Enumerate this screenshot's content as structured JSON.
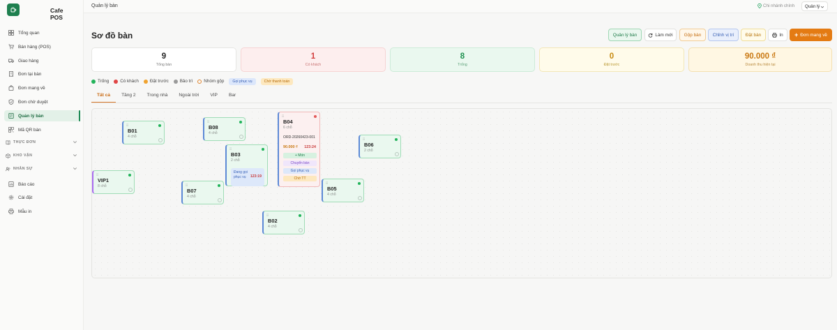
{
  "app": {
    "brand": "Cafe POS",
    "logo_icon": "cup-icon",
    "accent": "#1e7f4f"
  },
  "sidebar": {
    "items": [
      {
        "label": "Tổng quan",
        "icon": "grid-icon"
      },
      {
        "label": "Bán hàng (POS)",
        "icon": "cart-icon"
      },
      {
        "label": "Giao hàng",
        "icon": "truck-icon"
      },
      {
        "label": "Đơn tại bàn",
        "icon": "receipt-icon"
      },
      {
        "label": "Đơn mang về",
        "icon": "bag-icon"
      },
      {
        "label": "Đơn chờ duyệt",
        "icon": "shield-icon"
      },
      {
        "label": "Quản lý bàn",
        "icon": "table-icon",
        "active": true
      },
      {
        "label": "Mã QR bàn",
        "icon": "qr-icon"
      }
    ],
    "sections": [
      {
        "label": "THỰC ĐƠN",
        "icon": "book-icon"
      },
      {
        "label": "KHO VẬN",
        "icon": "box-icon"
      },
      {
        "label": "NHÂN SỰ",
        "icon": "people-icon"
      }
    ],
    "bottom_items": [
      {
        "label": "Báo cáo",
        "icon": "report-icon"
      },
      {
        "label": "Cài đặt",
        "icon": "gear-icon"
      },
      {
        "label": "Mẫu in",
        "icon": "printer-icon"
      }
    ]
  },
  "topbar": {
    "breadcrumb": "Quản lý bàn",
    "branch": "Chi nhánh chính",
    "role": "Quản lý"
  },
  "header": {
    "title": "Sơ đồ bàn",
    "buttons": {
      "manage": "Quản lý bàn",
      "refresh": "Làm mới",
      "merge": "Gộp bàn",
      "edit_position": "Chỉnh vị trí",
      "reserve": "Đặt bàn",
      "print": "In",
      "takeaway": "Đơn mang về"
    }
  },
  "stats": [
    {
      "value": "9",
      "label": "Tổng bàn"
    },
    {
      "value": "1",
      "label": "Có khách"
    },
    {
      "value": "8",
      "label": "Trống"
    },
    {
      "value": "0",
      "label": "Đặt trước"
    },
    {
      "value": "90.000 ₫",
      "label": "Doanh thu hiện tại"
    }
  ],
  "legend": {
    "empty": "Trống",
    "occupied": "Có khách",
    "reserved": "Đặt trước",
    "maintenance": "Bảo trì",
    "merge_group": "Nhóm gộp",
    "call_service": "Gọi phục vụ",
    "wait_payment": "Chờ thanh toán"
  },
  "tabs": [
    "Tất cả",
    "Tầng 2",
    "Trong nhà",
    "Ngoài trời",
    "VIP",
    "Bar"
  ],
  "tables": {
    "B01": {
      "name": "B01",
      "seats": "4 chỗ"
    },
    "B08": {
      "name": "B08",
      "seats": "4 chỗ"
    },
    "B03": {
      "name": "B03",
      "seats": "2 chỗ",
      "call_text": "Đang gọi phục vụ",
      "call_time": "123:19"
    },
    "B04": {
      "name": "B04",
      "seats": "6 chỗ",
      "order_id": "ORD-20260423-001",
      "amount": "90.000 ₫",
      "timer": "123:24",
      "actions": {
        "add_item": "+ Món",
        "transfer": "Chuyển bàn",
        "call": "Gọi phục vụ",
        "wait_payment": "Chờ TT"
      }
    },
    "B06": {
      "name": "B06",
      "seats": "2 chỗ"
    },
    "VIP1": {
      "name": "VIP1",
      "seats": "8 chỗ"
    },
    "B07": {
      "name": "B07",
      "seats": "4 chỗ"
    },
    "B05": {
      "name": "B05",
      "seats": "4 chỗ"
    },
    "B02": {
      "name": "B02",
      "seats": "4 chỗ"
    }
  }
}
